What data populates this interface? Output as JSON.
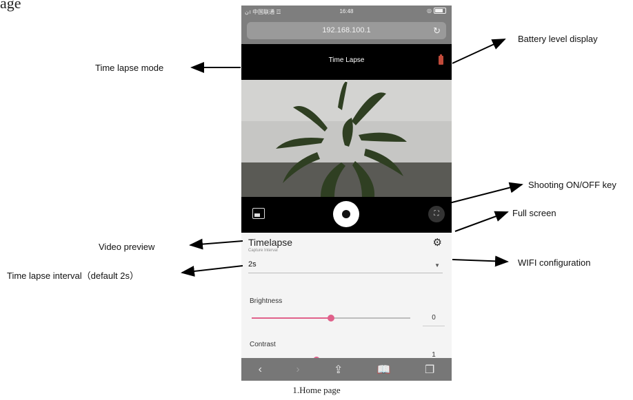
{
  "doc": {
    "top_fragment": "age",
    "caption": "1.Home page"
  },
  "annotations": {
    "time_lapse_mode": "Time lapse mode",
    "battery_level": "Battery level display",
    "shooting_key": "Shooting ON/OFF key",
    "full_screen": "Full screen",
    "video_preview": "Video preview",
    "interval": "Time lapse interval（default 2s）",
    "wifi_config": "WIFI configuration"
  },
  "phone": {
    "status": {
      "carrier": "ن। 中国联通 ☲",
      "time": "16:48"
    },
    "url": "192.168.100.1",
    "app_title": "Time Lapse",
    "panel": {
      "title": "Timelapse",
      "subtitle": "Capture Interval",
      "interval_value": "2s",
      "brightness_label": "Brightness",
      "brightness_value": "0",
      "brightness_level": 0.5,
      "contrast_label": "Contrast",
      "contrast_value": "1"
    }
  },
  "colors": {
    "accent": "#e0608a",
    "battery": "#c04a3a"
  },
  "icons": [
    "gallery-icon",
    "shutter-icon",
    "fullscreen-icon",
    "gear-icon",
    "back-icon",
    "forward-icon",
    "share-icon",
    "bookmarks-icon",
    "tabs-icon",
    "reload-icon"
  ]
}
